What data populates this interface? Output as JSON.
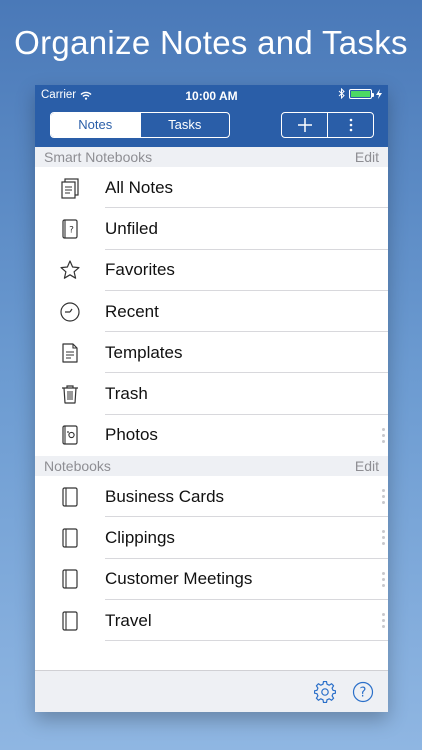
{
  "headline": "Organize Notes and Tasks",
  "status": {
    "carrier": "Carrier",
    "time": "10:00 AM"
  },
  "tabs": {
    "notes": "Notes",
    "tasks": "Tasks"
  },
  "sections": {
    "smart": {
      "title": "Smart Notebooks",
      "edit": "Edit"
    },
    "notebooks": {
      "title": "Notebooks",
      "edit": "Edit"
    }
  },
  "smart_items": [
    {
      "label": "All Notes",
      "icon": "all-notes-icon"
    },
    {
      "label": "Unfiled",
      "icon": "unfiled-icon"
    },
    {
      "label": "Favorites",
      "icon": "star-icon"
    },
    {
      "label": "Recent",
      "icon": "clock-icon"
    },
    {
      "label": "Templates",
      "icon": "template-icon"
    },
    {
      "label": "Trash",
      "icon": "trash-icon"
    },
    {
      "label": "Photos",
      "icon": "photos-icon"
    }
  ],
  "notebook_items": [
    {
      "label": "Business Cards",
      "icon": "notebook-icon"
    },
    {
      "label": "Clippings",
      "icon": "notebook-icon"
    },
    {
      "label": "Customer Meetings",
      "icon": "notebook-icon"
    },
    {
      "label": "Travel",
      "icon": "notebook-icon"
    }
  ],
  "colors": {
    "accent": "#2a5ea8",
    "icon_blue": "#2a6fc9"
  }
}
